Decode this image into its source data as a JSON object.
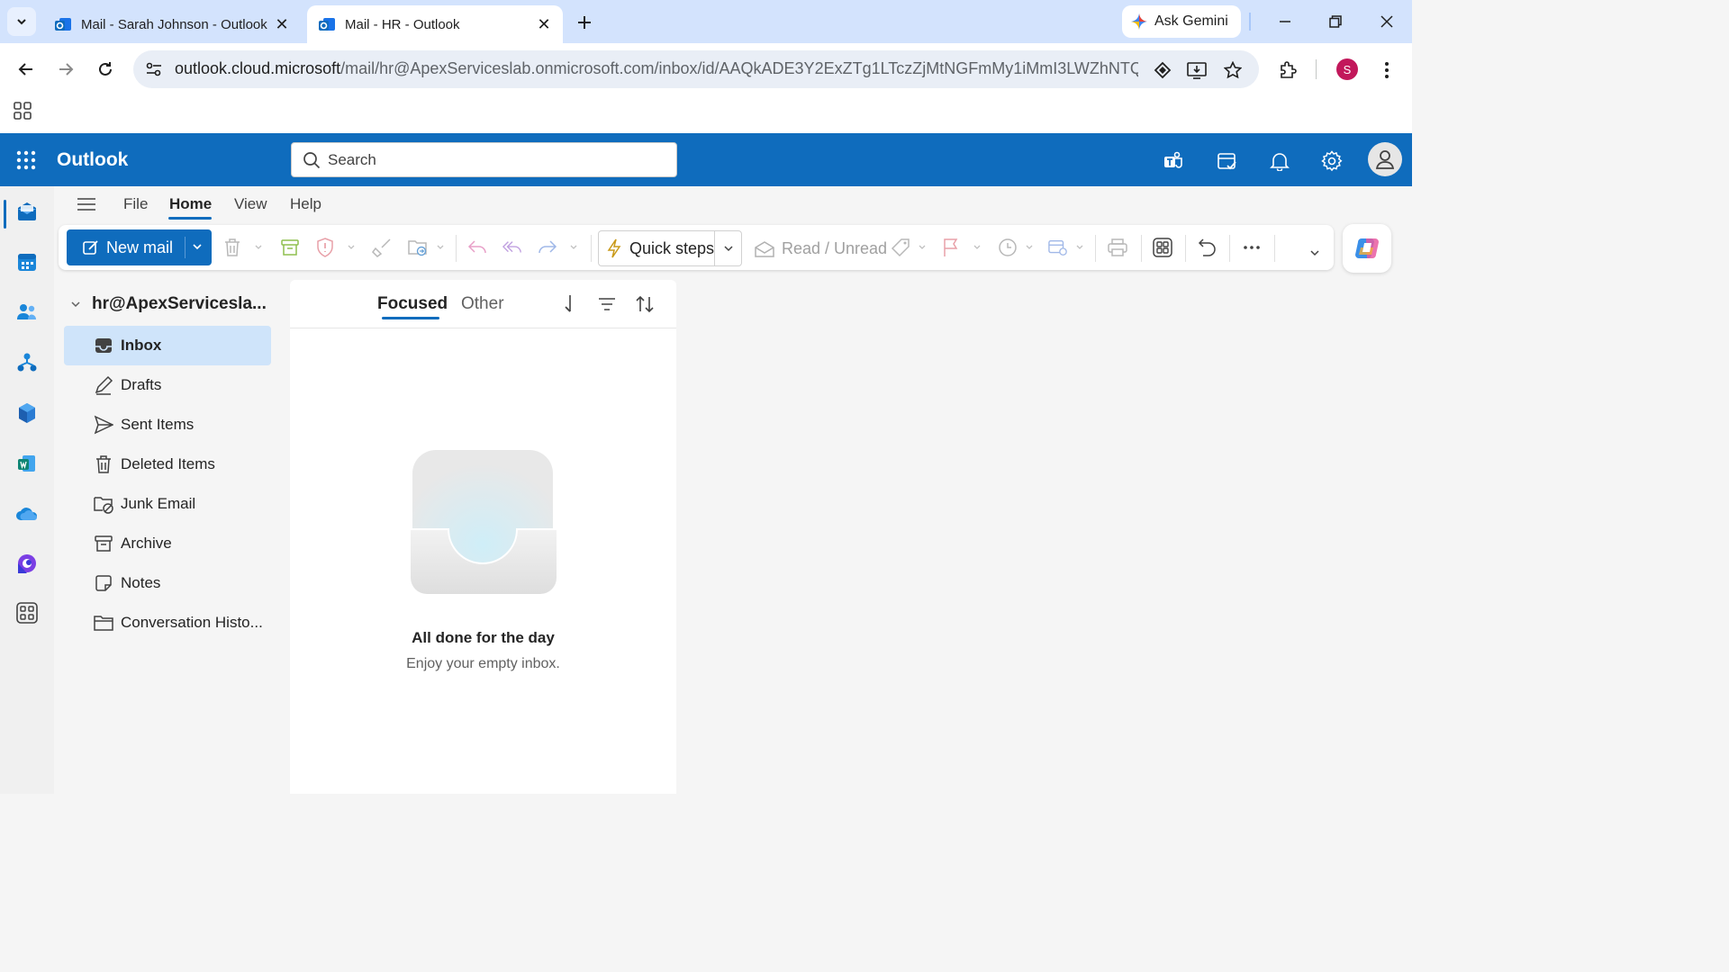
{
  "browser": {
    "tabs": [
      {
        "title": "Mail - Sarah Johnson - Outlook",
        "active": false
      },
      {
        "title": "Mail - HR - Outlook",
        "active": true
      }
    ],
    "gemini_label": "Ask Gemini",
    "url_host": "outlook.cloud.microsoft",
    "url_path": "/mail/hr@ApexServiceslab.onmicrosoft.com/inbox/id/AAQkADE3Y2ExZTg1LTczZjMtNGFmMy1iMmI3LWZhNTQxNjE2...",
    "profile_initial": "S",
    "profile_color": "#c2185b"
  },
  "outlook": {
    "brand": "Outlook",
    "brand_color": "#0f6cbd",
    "search_placeholder": "Search",
    "menu": [
      "File",
      "Home",
      "View",
      "Help"
    ],
    "active_menu": "Home",
    "ribbon": {
      "new_mail": "New mail",
      "quick_steps": "Quick steps",
      "read_unread": "Read / Unread"
    },
    "account": "hr@ApexServicesla...",
    "folders": [
      {
        "label": "Inbox",
        "icon": "inbox-icon",
        "selected": true
      },
      {
        "label": "Drafts",
        "icon": "drafts-icon",
        "selected": false
      },
      {
        "label": "Sent Items",
        "icon": "send-icon",
        "selected": false
      },
      {
        "label": "Deleted Items",
        "icon": "trash-icon",
        "selected": false
      },
      {
        "label": "Junk Email",
        "icon": "junk-icon",
        "selected": false
      },
      {
        "label": "Archive",
        "icon": "archive-icon",
        "selected": false
      },
      {
        "label": "Notes",
        "icon": "notes-icon",
        "selected": false
      },
      {
        "label": "Conversation Histo...",
        "icon": "folder-icon",
        "selected": false
      }
    ],
    "list_tabs": {
      "focused": "Focused",
      "other": "Other"
    },
    "empty": {
      "title": "All done for the day",
      "subtitle": "Enjoy your empty inbox."
    }
  }
}
